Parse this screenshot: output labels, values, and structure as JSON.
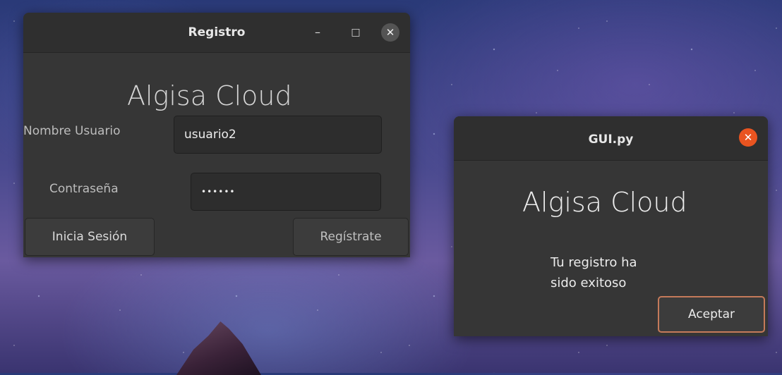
{
  "registro": {
    "title": "Registro",
    "app_name": "Algisa Cloud",
    "username_label": "Nombre Usuario",
    "username_value": "usuario2",
    "password_label": "Contraseña",
    "password_value": "••••••",
    "login_button": "Inicia Sesión",
    "register_button": "Regístrate",
    "controls": {
      "minimize": "–",
      "maximize": "□",
      "close": "✕"
    }
  },
  "dialog": {
    "title": "GUI.py",
    "app_name": "Algisa Cloud",
    "message_line1": "Tu registro ha",
    "message_line2": "sido exitoso",
    "accept_button": "Aceptar",
    "close": "✕"
  },
  "colors": {
    "accent": "#e95420"
  }
}
